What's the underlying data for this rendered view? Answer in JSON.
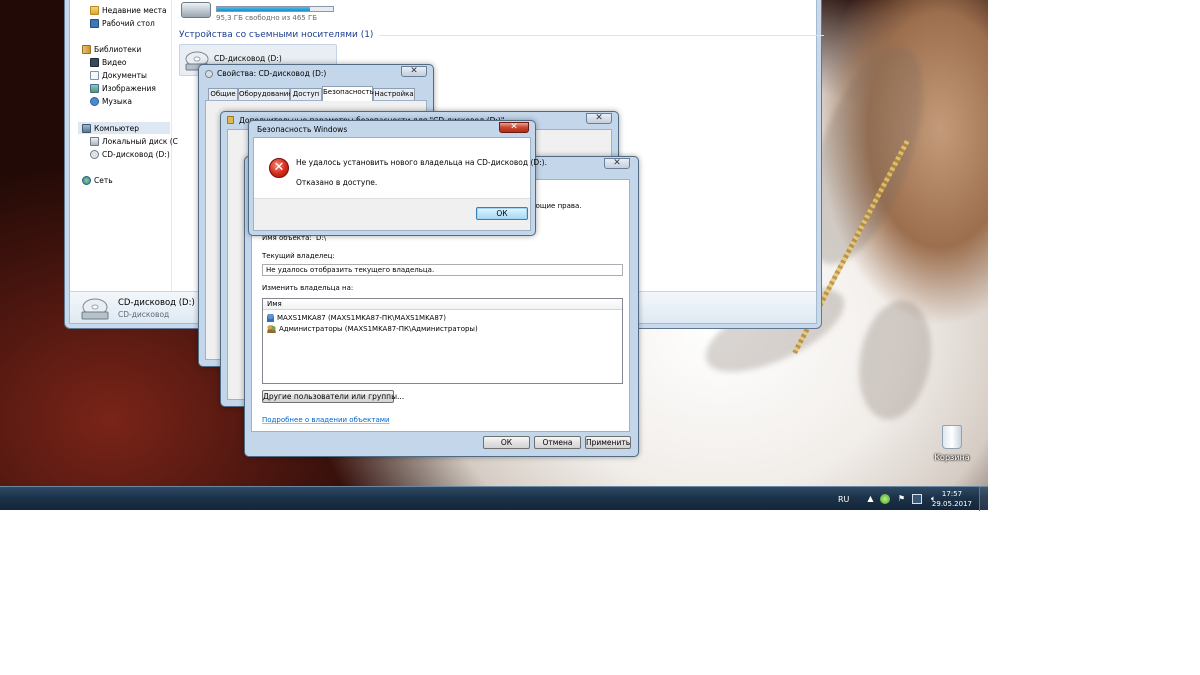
{
  "explorer": {
    "nav": {
      "recent": "Недавние места",
      "desktop": "Рабочий стол",
      "libraries": "Библиотеки",
      "video": "Видео",
      "documents": "Документы",
      "pictures": "Изображения",
      "music": "Музыка",
      "computer": "Компьютер",
      "local_disk": "Локальный диск (C",
      "cd_drive": "CD-дисковод (D:)",
      "network": "Сеть"
    },
    "drive_free": "95,3 ГБ свободно из 465 ГБ",
    "drive_used_fraction": 0.8,
    "removable_group": "Устройства со съемными носителями (1)",
    "cd_tile_label": "CD-дисковод (D:)",
    "details_name": "CD-дисковод (D:)",
    "details_sub": "CD-дисковод"
  },
  "properties": {
    "title": "Свойства: CD-дисковод (D:)",
    "tabs": [
      "Общие",
      "Оборудование",
      "Доступ",
      "Безопасность",
      "Настройка"
    ]
  },
  "advanced": {
    "title": "Дополнительные параметры безопасности для \"CD-дисковод (D:)\""
  },
  "owner_dialog": {
    "hint": "ющие права.",
    "object_name_label": "Имя объекта:",
    "object_name_value": "D:\\",
    "current_owner_label": "Текущий владелец:",
    "current_owner_value": "Не удалось отобразить текущего владельца.",
    "change_owner_label": "Изменить владельца на:",
    "column_name": "Имя",
    "rows": [
      "MAXS1MKA87 (MAXS1MKA87-ПК\\MAXS1MKA87)",
      "Администраторы (MAXS1MKA87-ПК\\Администраторы)"
    ],
    "other_users_button": "Другие пользователи или группы...",
    "learn_link": "Подробнее о владении объектами",
    "ok": "ОК",
    "cancel": "Отмена",
    "apply": "Применить"
  },
  "error_dialog": {
    "title": "Безопасность Windows",
    "message": "Не удалось установить нового владельца на CD-дисковод (D:).",
    "detail": "Отказано в доступе.",
    "ok": "ОК"
  },
  "desktop": {
    "recycle_bin": "Корзина"
  },
  "taskbar": {
    "language": "RU",
    "time": "17:57",
    "date": "29.05.2017"
  },
  "colors": {
    "accent_link": "#0066cc",
    "error_red": "#d12a1a",
    "taskbar": "#1c324a"
  }
}
